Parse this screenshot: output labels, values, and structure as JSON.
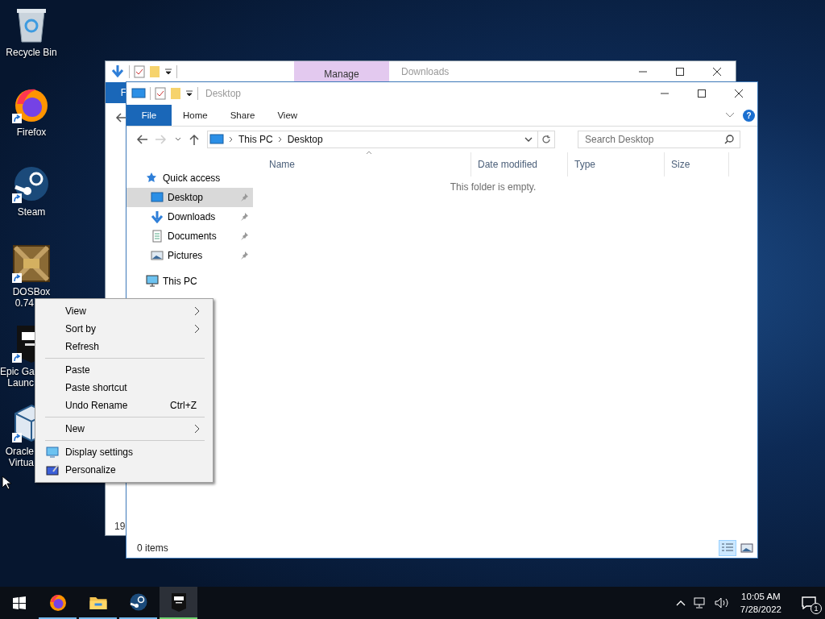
{
  "desktop_icons": [
    {
      "kind": "recycle",
      "lines": [
        "Recycle Bin"
      ],
      "shortcut": false
    },
    {
      "kind": "firefox",
      "lines": [
        "Firefox"
      ],
      "shortcut": true
    },
    {
      "kind": "steam",
      "lines": [
        "Steam"
      ],
      "shortcut": true
    },
    {
      "kind": "dosbox",
      "lines": [
        "DOSBox",
        "0.74"
      ],
      "shortcut": true
    },
    {
      "kind": "epic",
      "lines": [
        "Epic Ga",
        "Launc"
      ],
      "shortcut": true
    },
    {
      "kind": "virtualbox",
      "lines": [
        "Oracle",
        "Virtua"
      ],
      "shortcut": true
    }
  ],
  "back_window": {
    "context_tab": "Manage",
    "title": "Downloads",
    "ribbon_tab": "F",
    "footer_text": "19"
  },
  "front_window": {
    "title": "Desktop",
    "ribbon_tabs": [
      {
        "label": "File",
        "kind": "file"
      },
      {
        "label": "Home",
        "kind": "tab"
      },
      {
        "label": "Share",
        "kind": "tab"
      },
      {
        "label": "View",
        "kind": "tab"
      }
    ],
    "help_glyph": "?",
    "forward_disabled": true,
    "breadcrumb": [
      "This PC",
      "Desktop"
    ],
    "search": {
      "placeholder": "Search Desktop"
    },
    "nav": [
      {
        "label": "Quick access",
        "kind": "star",
        "selected": false,
        "children": [
          {
            "label": "Desktop",
            "kind": "desktop",
            "selected": true,
            "pinned": true
          },
          {
            "label": "Downloads",
            "kind": "download",
            "selected": false,
            "pinned": true
          },
          {
            "label": "Documents",
            "kind": "document",
            "selected": false,
            "pinned": true
          },
          {
            "label": "Pictures",
            "kind": "pictures",
            "selected": false,
            "pinned": true
          }
        ]
      },
      {
        "label": "This PC",
        "kind": "pc",
        "selected": false
      }
    ],
    "columns": [
      "Name",
      "Date modified",
      "Type",
      "Size"
    ],
    "empty_message": "This folder is empty.",
    "status": "0 items",
    "views": [
      {
        "kind": "details",
        "selected": true
      },
      {
        "kind": "large",
        "selected": false
      }
    ]
  },
  "context_menu": [
    {
      "kind": "item",
      "label": "View",
      "submenu": true
    },
    {
      "kind": "item",
      "label": "Sort by",
      "submenu": true
    },
    {
      "kind": "item",
      "label": "Refresh",
      "submenu": false
    },
    {
      "kind": "separator"
    },
    {
      "kind": "item",
      "label": "Paste",
      "submenu": false
    },
    {
      "kind": "item",
      "label": "Paste shortcut",
      "submenu": false
    },
    {
      "kind": "item",
      "label": "Undo Rename",
      "shortcut": "Ctrl+Z",
      "submenu": false
    },
    {
      "kind": "separator"
    },
    {
      "kind": "item",
      "label": "New",
      "submenu": true
    },
    {
      "kind": "separator"
    },
    {
      "kind": "display",
      "label": "Display settings",
      "submenu": false
    },
    {
      "kind": "personalize",
      "label": "Personalize",
      "submenu": false
    }
  ],
  "taskbar": {
    "apps": [
      {
        "kind": "firefox",
        "running": true,
        "active": false
      },
      {
        "kind": "explorer",
        "running": true,
        "active": false
      },
      {
        "kind": "steam",
        "running": true,
        "active": false
      },
      {
        "kind": "epic",
        "running": true,
        "active": true
      }
    ],
    "time": "10:05 AM",
    "date": "7/28/2022",
    "notification_count": "1"
  }
}
